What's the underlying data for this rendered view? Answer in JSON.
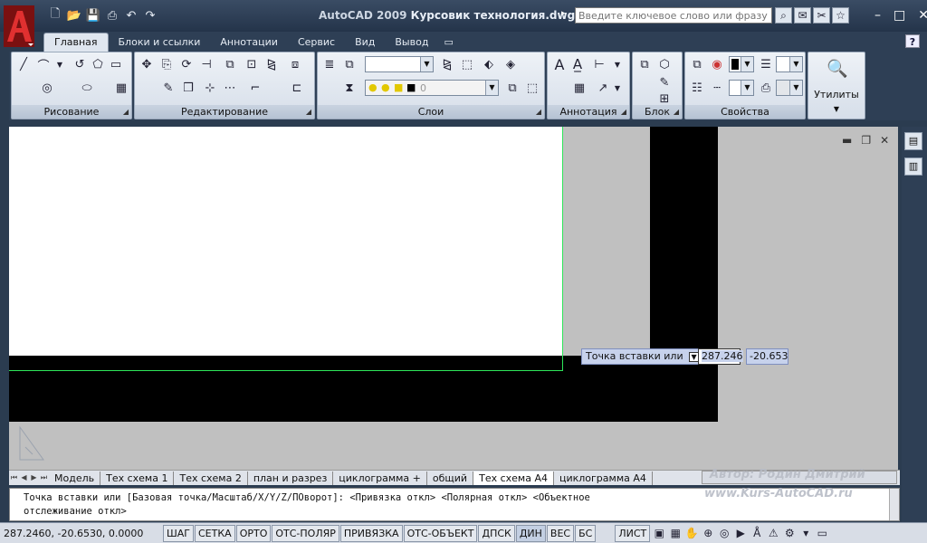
{
  "app": {
    "name": "AutoCAD 2009",
    "file": "Курсовик технология.dwg",
    "search_placeholder": "Введите ключевое слово или фразу"
  },
  "ribbon_tabs": [
    {
      "label": "Главная",
      "active": true
    },
    {
      "label": "Блоки и ссылки"
    },
    {
      "label": "Аннотации"
    },
    {
      "label": "Сервис"
    },
    {
      "label": "Вид"
    },
    {
      "label": "Вывод"
    }
  ],
  "panels": {
    "draw": "Рисование",
    "modify": "Редактирование",
    "layers": "Слои",
    "annotation": "Аннотация",
    "block": "Блок",
    "properties": "Свойства",
    "utilities": "Утилиты",
    "layer_value": "0"
  },
  "tooltip": {
    "prompt": "Точка вставки или",
    "x": "287.246",
    "y": "-20.653"
  },
  "layout_tabs": [
    {
      "label": "Модель"
    },
    {
      "label": "Тех схема 1"
    },
    {
      "label": "Тех схема 2"
    },
    {
      "label": "план и разрез"
    },
    {
      "label": "циклограмма +"
    },
    {
      "label": "общий"
    },
    {
      "label": "Тех схема А4",
      "active": true
    },
    {
      "label": "циклограмма А4"
    }
  ],
  "watermark": {
    "author": "Автор: Родин Дмитрий",
    "site": "www.Kurs-AutoCAD.ru"
  },
  "command": {
    "line1": "Точка вставки или [Базовая точка/Масштаб/X/Y/Z/ПОворот]:  <Привязка откл>  <Полярная откл>  <Объектное",
    "line2": "отслеживание откл>"
  },
  "status": {
    "coords": "287.2460, -20.6530, 0.0000",
    "toggles": [
      {
        "label": "ШАГ"
      },
      {
        "label": "СЕТКА"
      },
      {
        "label": "ОРТО"
      },
      {
        "label": "ОТС-ПОЛЯР"
      },
      {
        "label": "ПРИВЯЗКА"
      },
      {
        "label": "ОТС-ОБЪЕКТ"
      },
      {
        "label": "ДПСК"
      },
      {
        "label": "ДИН",
        "on": true
      },
      {
        "label": "ВЕС"
      },
      {
        "label": "БС"
      }
    ],
    "sheet": "ЛИСТ"
  }
}
